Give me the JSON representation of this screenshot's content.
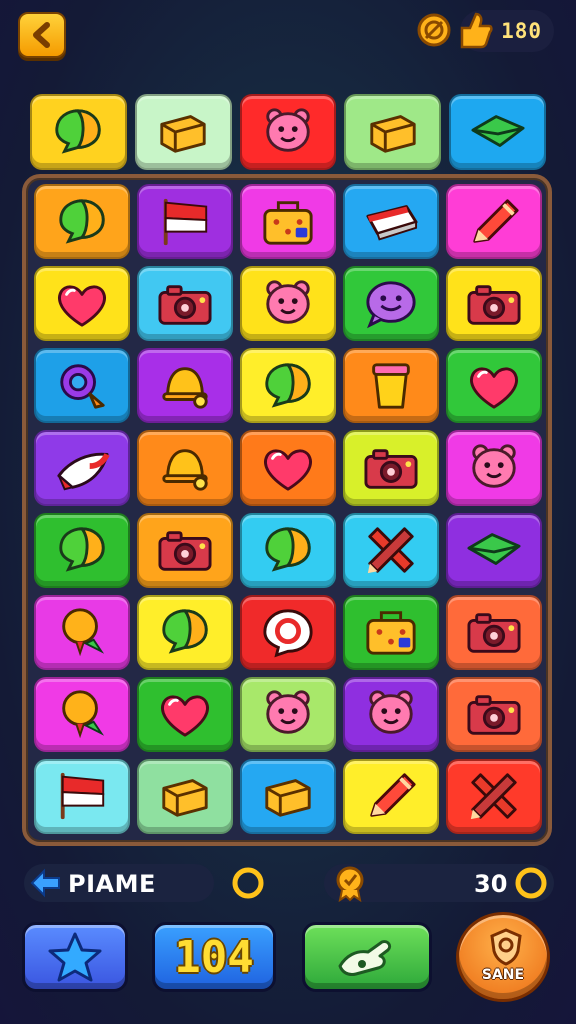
{
  "hud": {
    "coins": "180",
    "back_icon": "chevron-left-icon",
    "medal_icon": "medal-icon",
    "thumb_icon": "thumbs-up-icon"
  },
  "top_row": [
    {
      "icon": "speech-bubble-icon",
      "bg": "#ffd21f"
    },
    {
      "icon": "block-icon",
      "bg": "#c8f5c8"
    },
    {
      "icon": "bear-face-icon",
      "bg": "#ff2a2a"
    },
    {
      "icon": "block-icon",
      "bg": "#9fe888"
    },
    {
      "icon": "envelope-icon",
      "bg": "#1ea8f0"
    }
  ],
  "board": [
    {
      "icon": "speech-bubble-icon",
      "bg": "#ffa41b"
    },
    {
      "icon": "flag-icon",
      "bg": "#9f2fe0"
    },
    {
      "icon": "lunchbox-icon",
      "bg": "#f03ae6"
    },
    {
      "icon": "eraser-icon",
      "bg": "#25a8f2"
    },
    {
      "icon": "pencil-icon",
      "bg": "#ff3dd6"
    },
    {
      "icon": "heart-icon",
      "bg": "#ffe21a"
    },
    {
      "icon": "camera-icon",
      "bg": "#41c8f2"
    },
    {
      "icon": "bear-face-icon",
      "bg": "#ffe21a"
    },
    {
      "icon": "smiley-bubble-icon",
      "bg": "#31c83a"
    },
    {
      "icon": "camera-icon",
      "bg": "#ffe21a"
    },
    {
      "icon": "magnifier-icon",
      "bg": "#1ea0e8"
    },
    {
      "icon": "bell-icon",
      "bg": "#a82fe8"
    },
    {
      "icon": "speech-bubble-icon",
      "bg": "#ffee2a"
    },
    {
      "icon": "cup-icon",
      "bg": "#ff8a1a"
    },
    {
      "icon": "heart-icon",
      "bg": "#31c83a"
    },
    {
      "icon": "rocket-icon",
      "bg": "#8f3ae8"
    },
    {
      "icon": "bell-icon",
      "bg": "#ff8a1a"
    },
    {
      "icon": "heart-icon",
      "bg": "#ff7a1a"
    },
    {
      "icon": "camera-icon",
      "bg": "#d8f02a"
    },
    {
      "icon": "bear-face-icon",
      "bg": "#f03ae6"
    },
    {
      "icon": "speech-bubble-icon",
      "bg": "#2fbf2f"
    },
    {
      "icon": "camera-icon",
      "bg": "#ffa41b"
    },
    {
      "icon": "speech-bubble-icon",
      "bg": "#33ccf2"
    },
    {
      "icon": "cross-icon",
      "bg": "#33ccf2"
    },
    {
      "icon": "envelope-icon",
      "bg": "#8f2fe0"
    },
    {
      "icon": "balloon-icon",
      "bg": "#e83ae6"
    },
    {
      "icon": "speech-bubble-icon",
      "bg": "#ffee2a"
    },
    {
      "icon": "ring-icon",
      "bg": "#f02a2a"
    },
    {
      "icon": "lunchbox-icon",
      "bg": "#2fbf2f"
    },
    {
      "icon": "camera-icon",
      "bg": "#ff6a3a"
    },
    {
      "icon": "balloon-icon",
      "bg": "#f03ae6"
    },
    {
      "icon": "heart-icon",
      "bg": "#2fbf2f"
    },
    {
      "icon": "bear-face-icon",
      "bg": "#a8e86a"
    },
    {
      "icon": "bear-face-icon",
      "bg": "#8f2fe0"
    },
    {
      "icon": "camera-icon",
      "bg": "#ff6a3a"
    },
    {
      "icon": "flag-icon",
      "bg": "#7ae8f0"
    },
    {
      "icon": "block-icon",
      "bg": "#8fe0a0"
    },
    {
      "icon": "block-icon",
      "bg": "#25a8f2"
    },
    {
      "icon": "pencil-icon",
      "bg": "#ffee2a"
    },
    {
      "icon": "cross-icon",
      "bg": "#ff3a2a"
    }
  ],
  "status": {
    "player_name": "PIAME",
    "score": "30"
  },
  "buttons": {
    "count_label": "104",
    "save_label": "SANE"
  }
}
